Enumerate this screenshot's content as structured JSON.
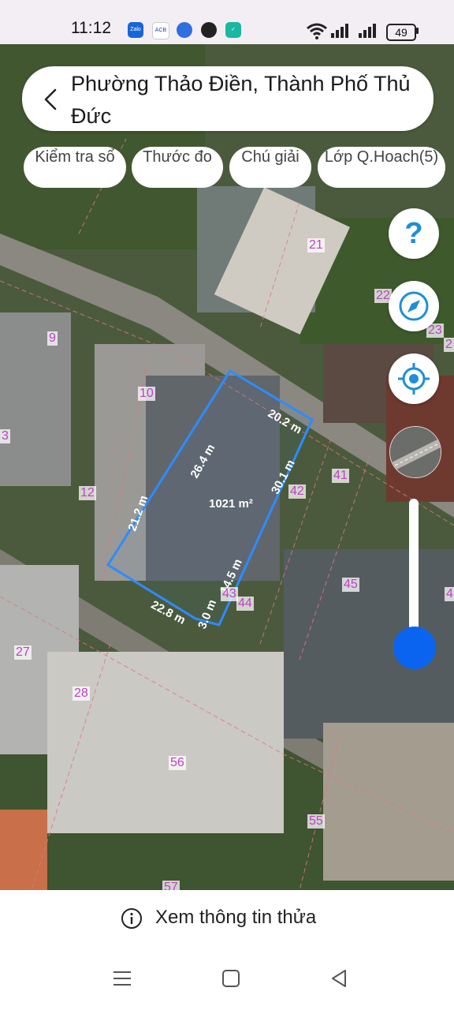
{
  "status_bar": {
    "time": "11:12",
    "notif_icons": [
      "zalo-icon",
      "acb-icon",
      "browser-icon",
      "chrome-icon",
      "vpn-icon"
    ],
    "battery": "49"
  },
  "header": {
    "title": "Phường Thảo Điền, Thành Phố Thủ Đức"
  },
  "toolbar": {
    "buttons": [
      {
        "label": "Kiểm tra sổ"
      },
      {
        "label": "Thước đo"
      },
      {
        "label": "Chú giải"
      },
      {
        "label": "Lớp Q.Hoach(5)"
      }
    ]
  },
  "map": {
    "parcel": {
      "area": "1021 m²",
      "edges": [
        "26.4 m",
        "20.2 m",
        "30.1 m",
        "14.5 m",
        "3.0 m",
        "22.8 m",
        "21.2 m"
      ]
    },
    "parcel_numbers": [
      "21",
      "22",
      "23",
      "2",
      "9",
      "10",
      "3",
      "12",
      "41",
      "42",
      "43",
      "44",
      "45",
      "4",
      "27",
      "28",
      "56",
      "55",
      "57"
    ],
    "highlight_color": "#2d8cff"
  },
  "footer": {
    "info_label": "Xem thông tin thửa"
  }
}
